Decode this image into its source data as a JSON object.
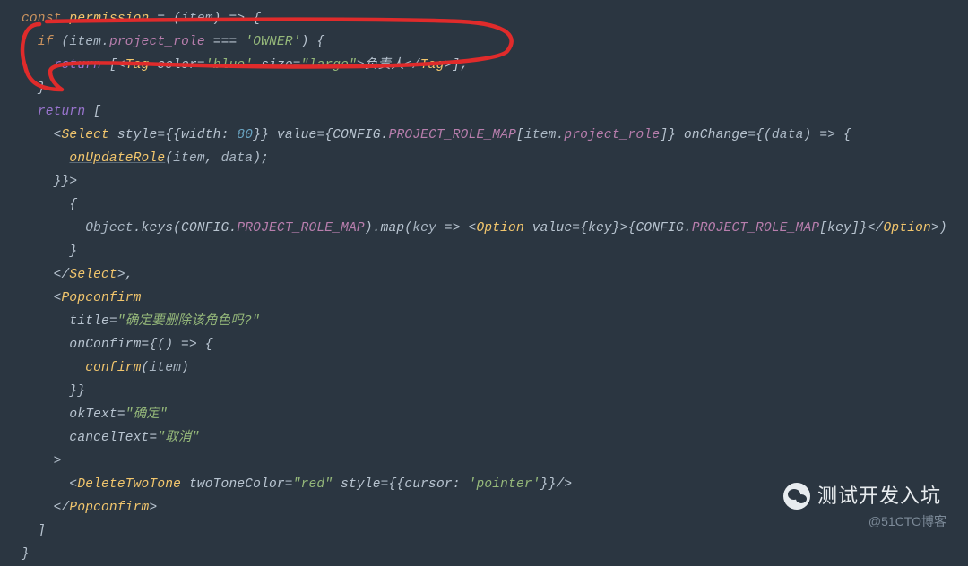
{
  "code": {
    "l1": {
      "kw1": "const",
      "fn": "permission",
      "op1": "= (",
      "p": "item",
      "op2": ") => {"
    },
    "l2": {
      "kw": "if",
      "p": "item",
      "prop": "project_role",
      "op": "=== ",
      "str": "'OWNER'",
      "tail": ") {"
    },
    "l3": {
      "ret": "return",
      "o": "[<",
      "tag": "Tag",
      "a1": "color",
      "v1": "'blue'",
      "a2": "size",
      "v2": "\"large\"",
      "txt": "负责人",
      "ctag": "Tag",
      "end": ">];"
    },
    "l4": {
      "c": "}"
    },
    "l5": {
      "ret": "return",
      "c": "["
    },
    "l6": {
      "o": "<",
      "tag": "Select",
      "a1": "style",
      "v1": "{{width: ",
      "num": "80",
      "v1b": "}}",
      "a2": "value",
      "v2a": "{CONFIG.",
      "v2b": "PROJECT_ROLE_MAP",
      "v2c": "[",
      "p": "item",
      "prop": "project_role",
      "v2d": "]}",
      "a3": "onChange",
      "v3": "{(",
      "p2": "data",
      "v3b": ") => {"
    },
    "l7": {
      "fn": "onUpdateRole",
      "o": "(",
      "p1": "item",
      "sep": ", ",
      "p2": "data",
      "c": ");"
    },
    "l8": {
      "c": "}}>"
    },
    "l9": {
      "c": "{"
    },
    "l10": {
      "obj": "Object",
      "m": ".keys(CONFIG.",
      "prop": "PROJECT_ROLE_MAP",
      "m2": ").map(",
      "p": "key",
      "arr": "=> <",
      "tag": "Option",
      "a": "value",
      "v": "{key}",
      "g": ">",
      "txt1": "{CONFIG.",
      "prop2": "PROJECT_ROLE_MAP",
      "txt2": "[key]}",
      "ct": "</",
      "ctag": "Option",
      "ce": ">)"
    },
    "l11": {
      "c": "}"
    },
    "l12": {
      "o": "</",
      "tag": "Select",
      "c": ">,"
    },
    "l13": {
      "o": "<",
      "tag": "Popconfirm"
    },
    "l14": {
      "a": "title",
      "eq": "=",
      "v": "\"确定要删除该角色吗?\""
    },
    "l15": {
      "a": "onConfirm",
      "eq": "=",
      "v": "{() => {"
    },
    "l16": {
      "fn": "confirm",
      "o": "(",
      "p": "item",
      "c": ")"
    },
    "l17": {
      "c": "}}"
    },
    "l18": {
      "a": "okText",
      "eq": "=",
      "v": "\"确定\""
    },
    "l19": {
      "a": "cancelText",
      "eq": "=",
      "v": "\"取消\""
    },
    "l20": {
      "c": ">"
    },
    "l21": {
      "o": "<",
      "tag": "DeleteTwoTone",
      "a1": "twoToneColor",
      "v1": "\"red\"",
      "a2": "style",
      "v2a": "{{cursor: ",
      "v2b": "'pointer'",
      "v2c": "}}",
      "end": "/>"
    },
    "l22": {
      "o": "</",
      "tag": "Popconfirm",
      "c": ">"
    },
    "l23": {
      "c": "]"
    },
    "l24": {
      "c": "}"
    }
  },
  "watermark": {
    "wechat": "测试开发入坑",
    "blog": "@51CTO博客"
  }
}
